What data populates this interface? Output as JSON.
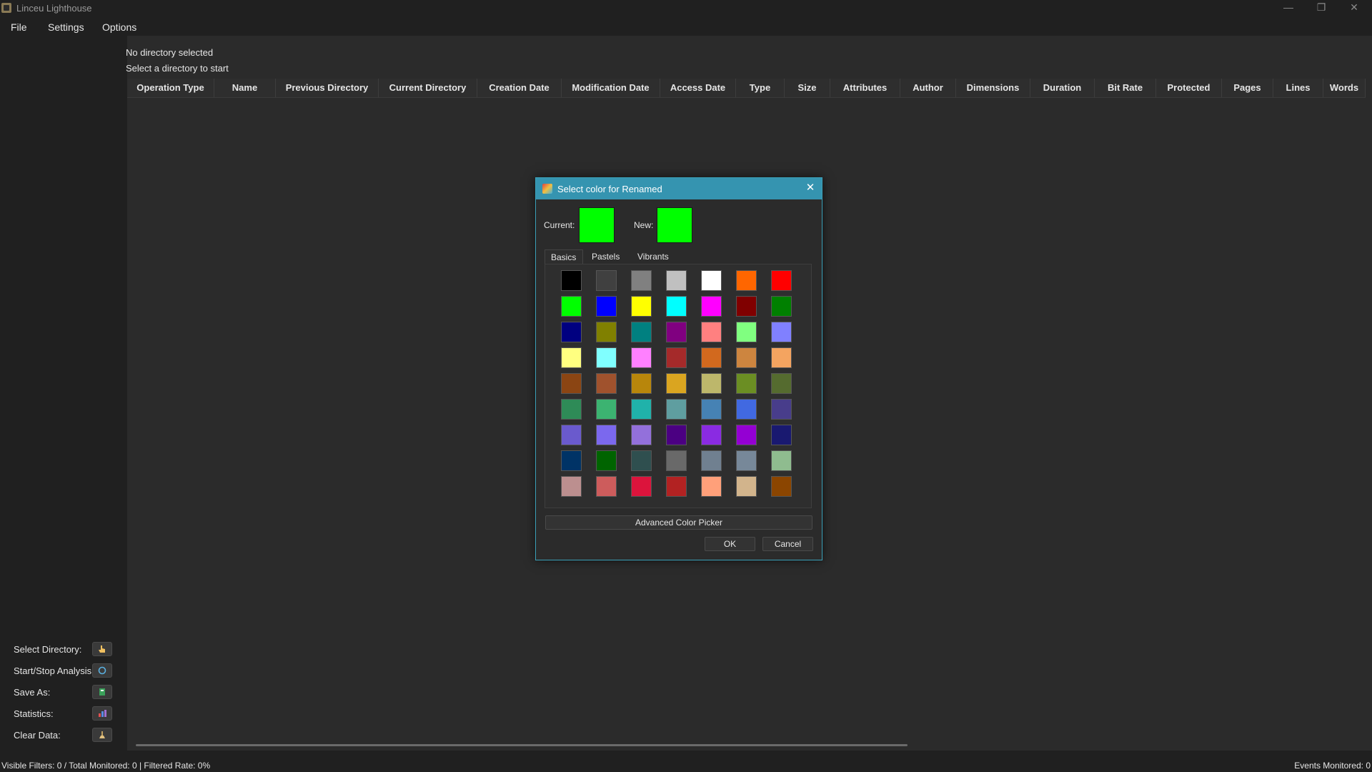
{
  "window": {
    "title": "Linceu Lighthouse",
    "minimize_glyph": "—",
    "restore_glyph": "❐",
    "close_glyph": "✕"
  },
  "menu": {
    "file": "File",
    "settings": "Settings",
    "options": "Options"
  },
  "info": {
    "line1": "No directory selected",
    "line2": "Select a directory to start"
  },
  "table": {
    "columns": [
      "Operation Type",
      "Name",
      "Previous Directory",
      "Current Directory",
      "Creation Date",
      "Modification Date",
      "Access Date",
      "Type",
      "Size",
      "Attributes",
      "Author",
      "Dimensions",
      "Duration",
      "Bit Rate",
      "Protected",
      "Pages",
      "Lines",
      "Words"
    ]
  },
  "sidebar": {
    "select_directory": "Select Directory:",
    "start_stop": "Start/Stop Analysis:",
    "save_as": "Save As:",
    "statistics": "Statistics:",
    "clear_data": "Clear Data:"
  },
  "status": {
    "left": "Visible Filters: 0 / Total Monitored: 0 | Filtered Rate: 0%",
    "right": "Events Monitored: 0"
  },
  "dialog": {
    "title": "Select color for Renamed",
    "close_glyph": "✕",
    "current_label": "Current:",
    "new_label": "New:",
    "current_color": "#00ff00",
    "new_color": "#00ff00",
    "tabs": [
      "Basics",
      "Pastels",
      "Vibrants"
    ],
    "active_tab": "Basics",
    "palette": [
      [
        "#000000",
        "#404040",
        "#808080",
        "#c0c0c0",
        "#ffffff",
        "#ff6600",
        "#ff0000"
      ],
      [
        "#00ff00",
        "#0000ff",
        "#ffff00",
        "#00ffff",
        "#ff00ff",
        "#800000",
        "#008000"
      ],
      [
        "#000080",
        "#808000",
        "#008080",
        "#800080",
        "#ff8080",
        "#80ff80",
        "#8080ff"
      ],
      [
        "#ffff80",
        "#80ffff",
        "#ff80ff",
        "#a52a2a",
        "#d2691e",
        "#cd853f",
        "#f4a460"
      ],
      [
        "#8b4513",
        "#a0522d",
        "#b8860b",
        "#daa520",
        "#bdb76b",
        "#6b8e23",
        "#556b2f"
      ],
      [
        "#2e8b57",
        "#3cb371",
        "#20b2aa",
        "#5f9ea0",
        "#4682b4",
        "#4169e1",
        "#483d8b"
      ],
      [
        "#6a5acd",
        "#7b68ee",
        "#9370db",
        "#4b0082",
        "#8a2be2",
        "#9400d3",
        "#191970"
      ],
      [
        "#003366",
        "#006400",
        "#2f4f4f",
        "#696969",
        "#708090",
        "#778899",
        "#8fbc8f"
      ],
      [
        "#bc8f8f",
        "#cd5c5c",
        "#dc143c",
        "#b22222",
        "#ffa07a",
        "#d2b48c",
        "#8b4500"
      ]
    ],
    "advanced": "Advanced Color Picker",
    "ok": "OK",
    "cancel": "Cancel"
  }
}
